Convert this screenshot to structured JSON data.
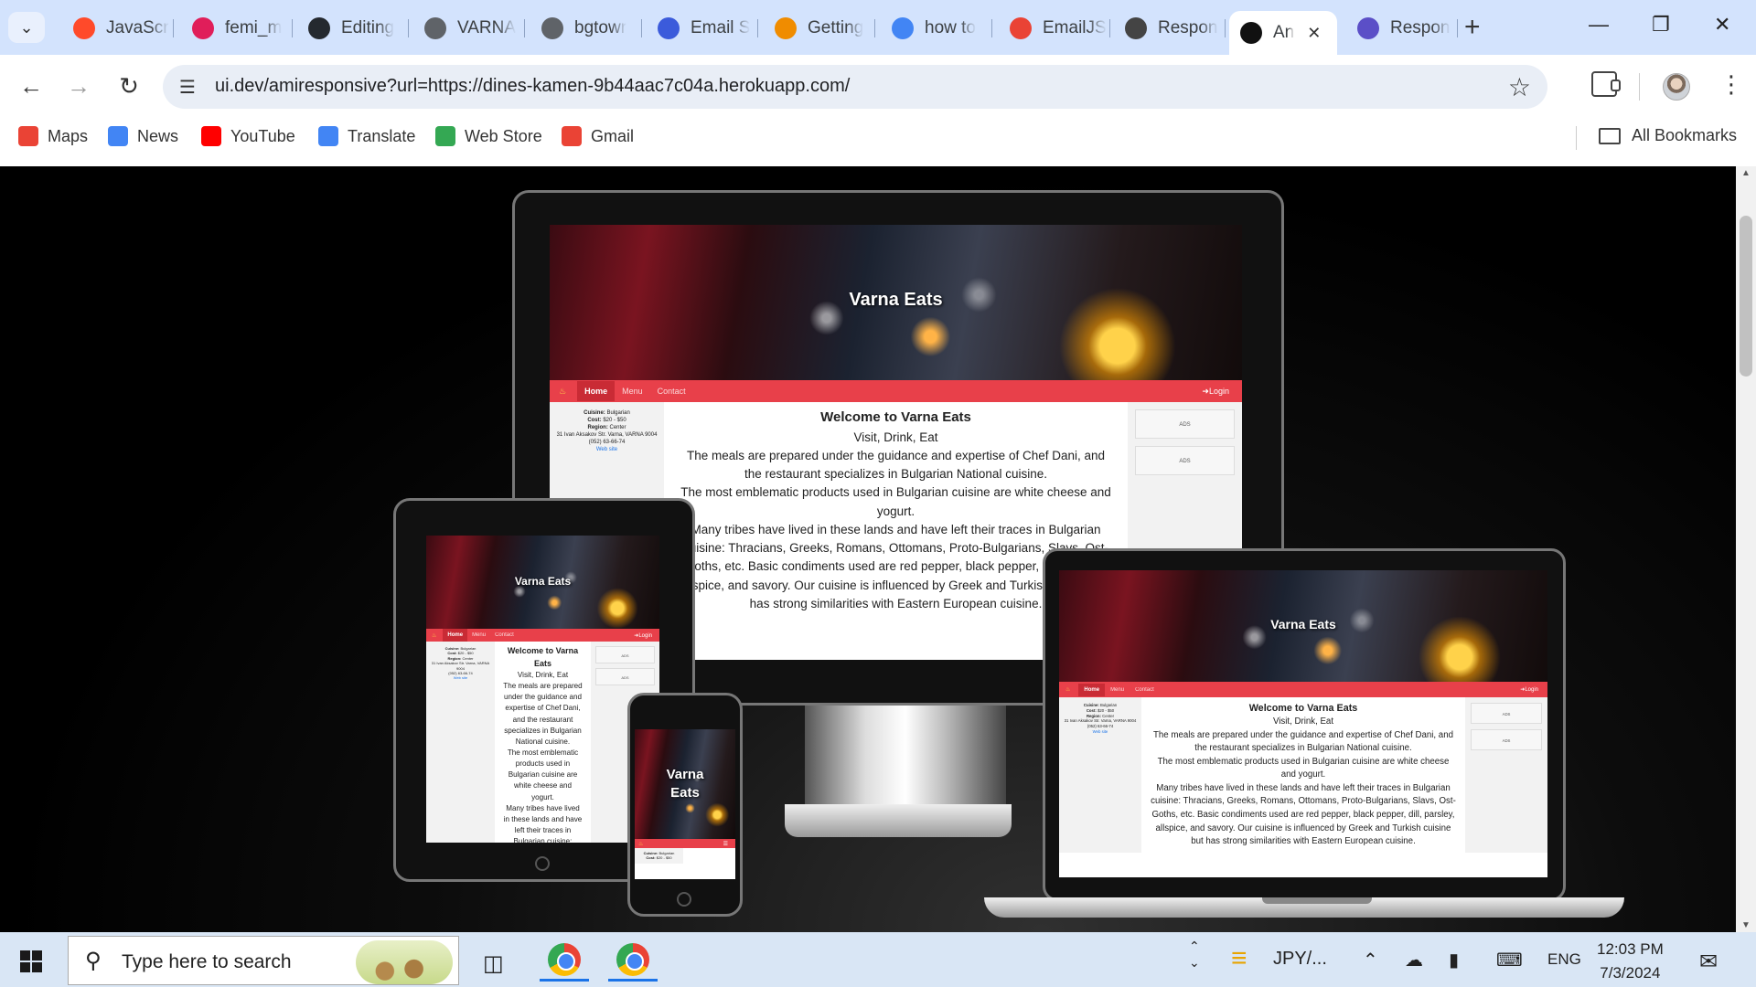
{
  "tabs": [
    {
      "title": "JavaScr",
      "icon": "opera-o-icon",
      "color": "#ff4a2a"
    },
    {
      "title": "femi_m",
      "icon": "slack-icon",
      "color": "#e01e5a"
    },
    {
      "title": "Editing",
      "icon": "github-icon",
      "color": "#24292f"
    },
    {
      "title": "VARNA",
      "icon": "globe-icon",
      "color": "#5f6368"
    },
    {
      "title": "bgtowr",
      "icon": "globe-icon",
      "color": "#5f6368"
    },
    {
      "title": "Email S",
      "icon": "shield-icon",
      "color": "#3b5bdb"
    },
    {
      "title": "Getting",
      "icon": "bookmark-orange-icon",
      "color": "#f08c00"
    },
    {
      "title": "how to",
      "icon": "google-icon",
      "color": "#4285f4"
    },
    {
      "title": "EmailJS",
      "icon": "gmail-icon",
      "color": "#ea4335"
    },
    {
      "title": "Respon",
      "icon": "devices-icon",
      "color": "#444444"
    },
    {
      "title": "An",
      "icon": "uidev-icon",
      "color": "#111111",
      "active": true
    },
    {
      "title": "Respon",
      "icon": "planet-icon",
      "color": "#5b4fc7"
    }
  ],
  "omnibox": {
    "url": "ui.dev/amiresponsive?url=https://dines-kamen-9b44aac7c04a.herokuapp.com/"
  },
  "bookmarks": [
    {
      "label": "Maps",
      "icon": "maps-pin-icon",
      "color": "#ea4335"
    },
    {
      "label": "News",
      "icon": "google-news-icon",
      "color": "#4285f4"
    },
    {
      "label": "YouTube",
      "icon": "youtube-icon",
      "color": "#ff0000"
    },
    {
      "label": "Translate",
      "icon": "translate-icon",
      "color": "#4285f4"
    },
    {
      "label": "Web Store",
      "icon": "web-store-icon",
      "color": "#34a853"
    },
    {
      "label": "Gmail",
      "icon": "gmail-icon",
      "color": "#ea4335"
    }
  ],
  "all_bookmarks": "All Bookmarks",
  "site": {
    "title": "Varna Eats",
    "nav": [
      "Home",
      "Menu",
      "Contact"
    ],
    "login": "Login",
    "sidebar": {
      "cuisine_label": "Cuisine:",
      "cuisine": "Bulgarian",
      "cost_label": "Cost:",
      "cost": "$20 - $50",
      "region_label": "Region:",
      "region": "Center",
      "address": "31 Ivan Aksakov Str. Varna, VARNA 9004",
      "phone": "(052) 63-66-74",
      "website": "Web site"
    },
    "heading": "Welcome to Varna Eats",
    "tagline": "Visit, Drink, Eat",
    "paragraphs": [
      "The meals are prepared under the guidance and expertise of Chef Dani, and the restaurant specializes in Bulgarian National cuisine.",
      "The most emblematic products used in Bulgarian cuisine are white cheese and yogurt.",
      "Many tribes have lived in these lands and have left their traces in Bulgarian cuisine: Thracians, Greeks, Romans, Ottomans, Proto-Bulgarians, Slavs, Ost-Goths, etc. Basic condiments used are red pepper, black pepper, dill, parsley, allspice, and savory. Our cuisine is influenced by Greek and Turkish cuisine but has strong similarities with Eastern European cuisine."
    ],
    "ads": [
      "ADS",
      "ADS"
    ]
  },
  "taskbar": {
    "search_placeholder": "Type here to search",
    "currency": "JPY/...",
    "lang": "ENG",
    "time": "12:03 PM",
    "date": "7/3/2024"
  }
}
